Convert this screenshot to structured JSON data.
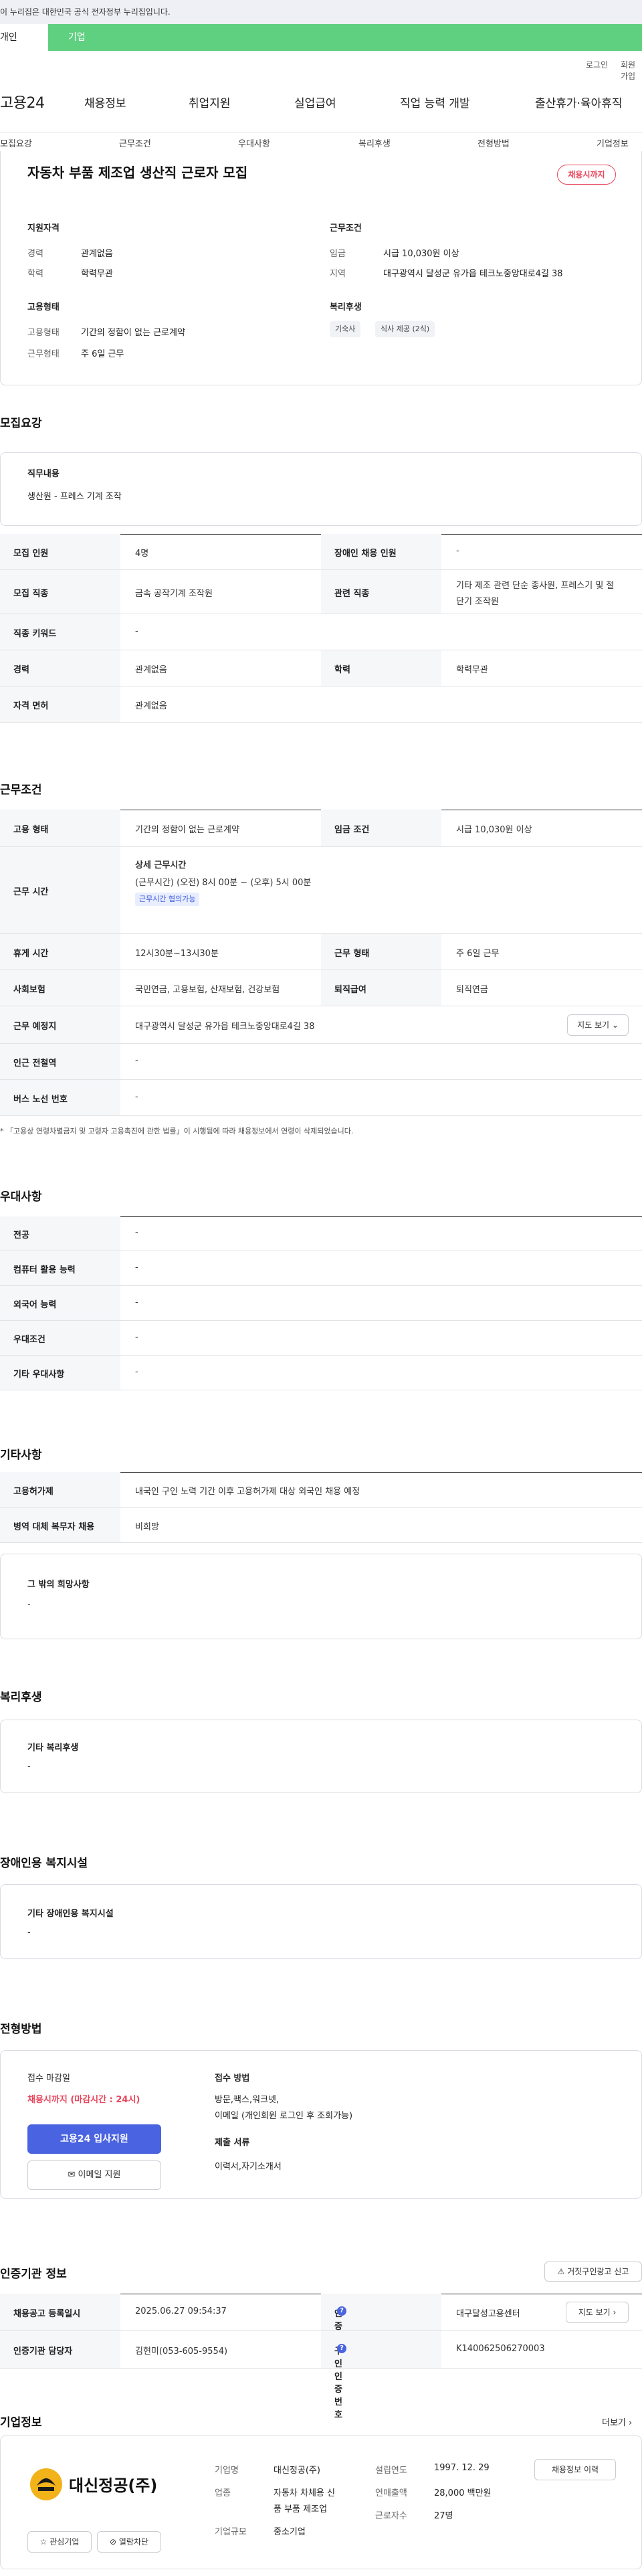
{
  "gov_banner": "이 누리집은 대한민국 공식 전자정부 누리집입니다.",
  "audience_tabs": {
    "person": "개인",
    "corporate": "기업"
  },
  "util_links": {
    "login": "로그인",
    "signup": "회원가입"
  },
  "logo": "고용24",
  "gnb": [
    "채용정보",
    "취업지원",
    "실업급여",
    "직업 능력 개발",
    "출산휴가·육아휴직"
  ],
  "sub_nav": [
    "모집요강",
    "근무조건",
    "우대사항",
    "복리후생",
    "전형방법",
    "기업정보"
  ],
  "summary": {
    "title": "자동차 부품 제조업 생산직 근로자 모집",
    "badge": "채용시까지",
    "qualification_heading": "지원자격",
    "career_label": "경력",
    "career_value": "관계없음",
    "education_label": "학력",
    "education_value": "학력무관",
    "conditions_heading": "근무조건",
    "wage_label": "임금",
    "wage_value": "시급 10,030원 이상",
    "region_label": "지역",
    "region_value": "대구광역시 달성군 유가읍 테크노중앙대로4길 38",
    "employment_heading": "고용형태",
    "emp_type_label": "고용형태",
    "emp_type_value": "기간의 정함이 없는 근로계약",
    "work_form_label": "근무형태",
    "work_form_value": "주 6일 근무",
    "welfare_heading": "복리후생",
    "welfare_chips": [
      "기숙사",
      "식사 제공 (2식)"
    ]
  },
  "recruit": {
    "heading": "모집요강",
    "duty_title": "직무내용",
    "duty_text": "생산원  - 프레스 기계 조작",
    "rows": {
      "headcount_label": "모집 인원",
      "headcount_value": "4명",
      "disabled_label": "장애인 채용 인원",
      "disabled_value": "-",
      "job_label": "모집 직종",
      "job_value": "금속 공작기계 조작원",
      "related_label": "관련 직종",
      "related_value_1": "기타 제조 관련 단순 종사원, 프레스기 및 절",
      "related_value_2": "단기 조작원",
      "keyword_label": "직종 키워드",
      "keyword_value": "-",
      "career_label": "경력",
      "career_value": "관계없음",
      "edu_label": "학력",
      "edu_value": "학력무관",
      "license_label": "자격 면허",
      "license_value": "관계없음"
    }
  },
  "conditions": {
    "heading": "근무조건",
    "emp_label": "고용 형태",
    "emp_value": "기간의 정함이 없는 근로계약",
    "wage_label": "임금 조건",
    "wage_value": "시급 10,030원 이상",
    "hours_label": "근무 시간",
    "hours_title": "상세 근무시간",
    "hours_value": "(근무시간) (오전) 8시 00분 ~ (오후) 5시 00분",
    "hours_tag": "근무시간 협의가능",
    "break_label": "휴게 시간",
    "break_value": "12시30분~13시30분",
    "form_label": "근무 형태",
    "form_value": "주 6일 근무",
    "insurance_label": "사회보험",
    "insurance_value": "국민연금, 고용보험, 산재보험, 건강보험",
    "retire_label": "퇴직급여",
    "retire_value": "퇴직연금",
    "place_label": "근무 예정지",
    "place_value": "대구광역시 달성군 유가읍 테크노중앙대로4길 38",
    "map_btn": "지도 보기",
    "subway_label": "인근 전철역",
    "subway_value": "-",
    "bus_label": "버스 노선 번호",
    "bus_value": "-",
    "note": "* 「고용상 연령차별금지 및 고령자 고용촉진에 관한 법률」이 시행됨에 따라 채용정보에서 연령이 삭제되었습니다."
  },
  "preference": {
    "heading": "우대사항",
    "rows": [
      {
        "label": "전공",
        "value": "-"
      },
      {
        "label": "컴퓨터 활용 능력",
        "value": "-"
      },
      {
        "label": "외국어 능력",
        "value": "-"
      },
      {
        "label": "우대조건",
        "value": "-"
      },
      {
        "label": "기타 우대사항",
        "value": "-"
      }
    ]
  },
  "other": {
    "heading": "기타사항",
    "foreign_label": "고용허가제",
    "foreign_value": "내국인 구인 노력 기간 이후 고용허가제 대상 외국인 채용 예정",
    "military_label": "병역 대체 복무자 채용",
    "military_value": "비희망",
    "etc_title": "그 밖의 희망사항",
    "etc_value": "-"
  },
  "welfare": {
    "heading": "복리후생",
    "card_title": "기타 복리후생",
    "card_value": "-"
  },
  "disabled_fac": {
    "heading": "장애인용 복지시설",
    "card_title": "기타 장애인용 복지시설",
    "card_value": "-"
  },
  "selection": {
    "heading": "전형방법",
    "deadline_title": "접수 마감일",
    "deadline_value": "채용시까지 (마감시간 : 24시)",
    "apply_btn": "고용24 입사지원",
    "email_btn": "이메일 지원",
    "method_title": "접수 방법",
    "method_value_1": "방문,팩스,워크넷,",
    "method_value_2": "이메일 (개인회원 로그인 후 조회가능)",
    "docs_title": "제출 서류",
    "docs_value": "이력서,자기소개서"
  },
  "cert": {
    "heading": "인증기관 정보",
    "report_btn": "거짓구인광고 신고",
    "reg_date_label": "채용공고 등록일시",
    "reg_date_value": "2025.06.27 09:54:37",
    "agency_label": "인증기관",
    "agency_value": "대구달성고용센터",
    "map_btn": "지도 보기",
    "manager_label": "인증기관 담당자",
    "manager_value": "김현미(053-605-9554)",
    "post_id_label": "구인인증번호",
    "post_id_value": "K140062506270003"
  },
  "company": {
    "heading": "기업정보",
    "more": "더보기",
    "logo_text": "대신정공(주)",
    "fav_btn": "관심기업",
    "block_btn": "열람차단",
    "name_label": "기업명",
    "name_value": "대신정공(주)",
    "industry_label": "업종",
    "industry_value_1": "자동차 차체용 신",
    "industry_value_2": "품 부품 제조업",
    "size_label": "기업규모",
    "size_value": "중소기업",
    "founded_label": "설립연도",
    "founded_value": "1997. 12. 29",
    "sales_label": "연매출액",
    "sales_value": "28,000 백만원",
    "staff_label": "근로자수",
    "staff_value": "27명",
    "jobs_btn": "채용정보 이력"
  }
}
